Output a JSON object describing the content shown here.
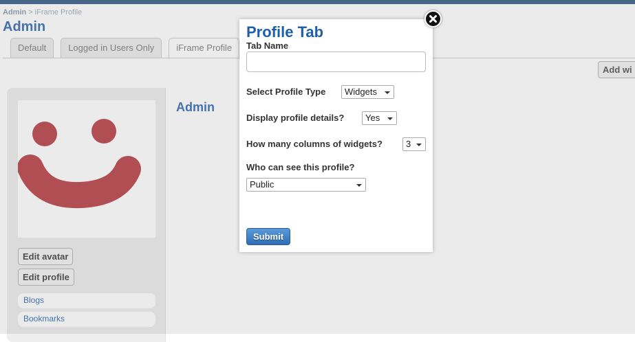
{
  "breadcrumb": {
    "root": "Admin",
    "sep": ">",
    "current": "iFrame Profile"
  },
  "page_title": "Admin",
  "tabs": [
    {
      "label": "Default"
    },
    {
      "label": "Logged in Users Only"
    },
    {
      "label": "iFrame Profile"
    }
  ],
  "add_widget_label": "Add wi",
  "owner": {
    "name": "Admin",
    "edit_avatar": "Edit avatar",
    "edit_profile": "Edit profile",
    "menu": [
      "Blogs",
      "Bookmarks"
    ]
  },
  "modal": {
    "title": "Profile Tab",
    "tab_name_label": "Tab Name",
    "tab_name_value": "",
    "profile_type_label": "Select Profile Type",
    "profile_type_value": "Widgets",
    "display_details_label": "Display profile details?",
    "display_details_value": "Yes",
    "columns_label": "How many columns of widgets?",
    "columns_value": "3",
    "visibility_label": "Who can see this profile?",
    "visibility_value": "Public",
    "submit_label": "Submit"
  },
  "colors": {
    "title_blue": "#1f5faa",
    "link_blue": "#4a7cb8",
    "avatar_red": "#c0555c"
  },
  "icons": {
    "close": "close-icon",
    "avatar": "smiley-avatar"
  }
}
